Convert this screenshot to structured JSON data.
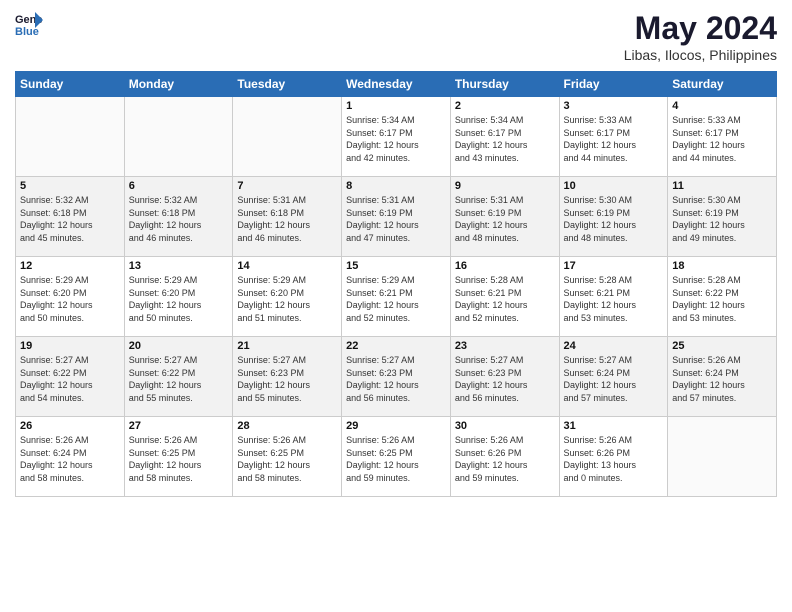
{
  "header": {
    "logo_line1": "General",
    "logo_line2": "Blue",
    "title": "May 2024",
    "subtitle": "Libas, Ilocos, Philippines"
  },
  "weekdays": [
    "Sunday",
    "Monday",
    "Tuesday",
    "Wednesday",
    "Thursday",
    "Friday",
    "Saturday"
  ],
  "weeks": [
    [
      {
        "day": "",
        "info": ""
      },
      {
        "day": "",
        "info": ""
      },
      {
        "day": "",
        "info": ""
      },
      {
        "day": "1",
        "info": "Sunrise: 5:34 AM\nSunset: 6:17 PM\nDaylight: 12 hours\nand 42 minutes."
      },
      {
        "day": "2",
        "info": "Sunrise: 5:34 AM\nSunset: 6:17 PM\nDaylight: 12 hours\nand 43 minutes."
      },
      {
        "day": "3",
        "info": "Sunrise: 5:33 AM\nSunset: 6:17 PM\nDaylight: 12 hours\nand 44 minutes."
      },
      {
        "day": "4",
        "info": "Sunrise: 5:33 AM\nSunset: 6:17 PM\nDaylight: 12 hours\nand 44 minutes."
      }
    ],
    [
      {
        "day": "5",
        "info": "Sunrise: 5:32 AM\nSunset: 6:18 PM\nDaylight: 12 hours\nand 45 minutes."
      },
      {
        "day": "6",
        "info": "Sunrise: 5:32 AM\nSunset: 6:18 PM\nDaylight: 12 hours\nand 46 minutes."
      },
      {
        "day": "7",
        "info": "Sunrise: 5:31 AM\nSunset: 6:18 PM\nDaylight: 12 hours\nand 46 minutes."
      },
      {
        "day": "8",
        "info": "Sunrise: 5:31 AM\nSunset: 6:19 PM\nDaylight: 12 hours\nand 47 minutes."
      },
      {
        "day": "9",
        "info": "Sunrise: 5:31 AM\nSunset: 6:19 PM\nDaylight: 12 hours\nand 48 minutes."
      },
      {
        "day": "10",
        "info": "Sunrise: 5:30 AM\nSunset: 6:19 PM\nDaylight: 12 hours\nand 48 minutes."
      },
      {
        "day": "11",
        "info": "Sunrise: 5:30 AM\nSunset: 6:19 PM\nDaylight: 12 hours\nand 49 minutes."
      }
    ],
    [
      {
        "day": "12",
        "info": "Sunrise: 5:29 AM\nSunset: 6:20 PM\nDaylight: 12 hours\nand 50 minutes."
      },
      {
        "day": "13",
        "info": "Sunrise: 5:29 AM\nSunset: 6:20 PM\nDaylight: 12 hours\nand 50 minutes."
      },
      {
        "day": "14",
        "info": "Sunrise: 5:29 AM\nSunset: 6:20 PM\nDaylight: 12 hours\nand 51 minutes."
      },
      {
        "day": "15",
        "info": "Sunrise: 5:29 AM\nSunset: 6:21 PM\nDaylight: 12 hours\nand 52 minutes."
      },
      {
        "day": "16",
        "info": "Sunrise: 5:28 AM\nSunset: 6:21 PM\nDaylight: 12 hours\nand 52 minutes."
      },
      {
        "day": "17",
        "info": "Sunrise: 5:28 AM\nSunset: 6:21 PM\nDaylight: 12 hours\nand 53 minutes."
      },
      {
        "day": "18",
        "info": "Sunrise: 5:28 AM\nSunset: 6:22 PM\nDaylight: 12 hours\nand 53 minutes."
      }
    ],
    [
      {
        "day": "19",
        "info": "Sunrise: 5:27 AM\nSunset: 6:22 PM\nDaylight: 12 hours\nand 54 minutes."
      },
      {
        "day": "20",
        "info": "Sunrise: 5:27 AM\nSunset: 6:22 PM\nDaylight: 12 hours\nand 55 minutes."
      },
      {
        "day": "21",
        "info": "Sunrise: 5:27 AM\nSunset: 6:23 PM\nDaylight: 12 hours\nand 55 minutes."
      },
      {
        "day": "22",
        "info": "Sunrise: 5:27 AM\nSunset: 6:23 PM\nDaylight: 12 hours\nand 56 minutes."
      },
      {
        "day": "23",
        "info": "Sunrise: 5:27 AM\nSunset: 6:23 PM\nDaylight: 12 hours\nand 56 minutes."
      },
      {
        "day": "24",
        "info": "Sunrise: 5:27 AM\nSunset: 6:24 PM\nDaylight: 12 hours\nand 57 minutes."
      },
      {
        "day": "25",
        "info": "Sunrise: 5:26 AM\nSunset: 6:24 PM\nDaylight: 12 hours\nand 57 minutes."
      }
    ],
    [
      {
        "day": "26",
        "info": "Sunrise: 5:26 AM\nSunset: 6:24 PM\nDaylight: 12 hours\nand 58 minutes."
      },
      {
        "day": "27",
        "info": "Sunrise: 5:26 AM\nSunset: 6:25 PM\nDaylight: 12 hours\nand 58 minutes."
      },
      {
        "day": "28",
        "info": "Sunrise: 5:26 AM\nSunset: 6:25 PM\nDaylight: 12 hours\nand 58 minutes."
      },
      {
        "day": "29",
        "info": "Sunrise: 5:26 AM\nSunset: 6:25 PM\nDaylight: 12 hours\nand 59 minutes."
      },
      {
        "day": "30",
        "info": "Sunrise: 5:26 AM\nSunset: 6:26 PM\nDaylight: 12 hours\nand 59 minutes."
      },
      {
        "day": "31",
        "info": "Sunrise: 5:26 AM\nSunset: 6:26 PM\nDaylight: 13 hours\nand 0 minutes."
      },
      {
        "day": "",
        "info": ""
      }
    ]
  ]
}
